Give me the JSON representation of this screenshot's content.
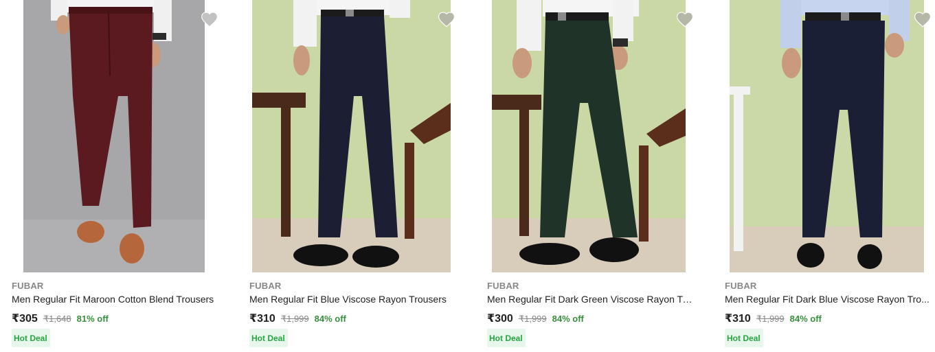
{
  "products": [
    {
      "brand": "FUBAR",
      "title": "Men Regular Fit Maroon Cotton Blend Trousers",
      "price": "₹305",
      "mrp": "₹1,648",
      "discount": "81% off",
      "badge": "Hot Deal",
      "trouser_color": "#5a1a20",
      "background_color": "#a6a6a8"
    },
    {
      "brand": "FUBAR",
      "title": "Men Regular Fit Blue Viscose Rayon Trousers",
      "price": "₹310",
      "mrp": "₹1,999",
      "discount": "84% off",
      "badge": "Hot Deal",
      "trouser_color": "#1c1f33",
      "background_color": "#c7d6a2"
    },
    {
      "brand": "FUBAR",
      "title": "Men Regular Fit Dark Green Viscose Rayon Tr...",
      "price": "₹300",
      "mrp": "₹1,999",
      "discount": "84% off",
      "badge": "Hot Deal",
      "trouser_color": "#1f3329",
      "background_color": "#c7d6a2"
    },
    {
      "brand": "FUBAR",
      "title": "Men Regular Fit Dark Blue Viscose Rayon Tro...",
      "price": "₹310",
      "mrp": "₹1,999",
      "discount": "84% off",
      "badge": "Hot Deal",
      "trouser_color": "#1a1f36",
      "background_color": "#c9d8a6"
    }
  ],
  "icons": {
    "wishlist": "heart-icon"
  },
  "colors": {
    "price_green": "#388e3c",
    "badge_bg": "#e8f7ec",
    "badge_text": "#26a541",
    "muted": "#878787"
  }
}
